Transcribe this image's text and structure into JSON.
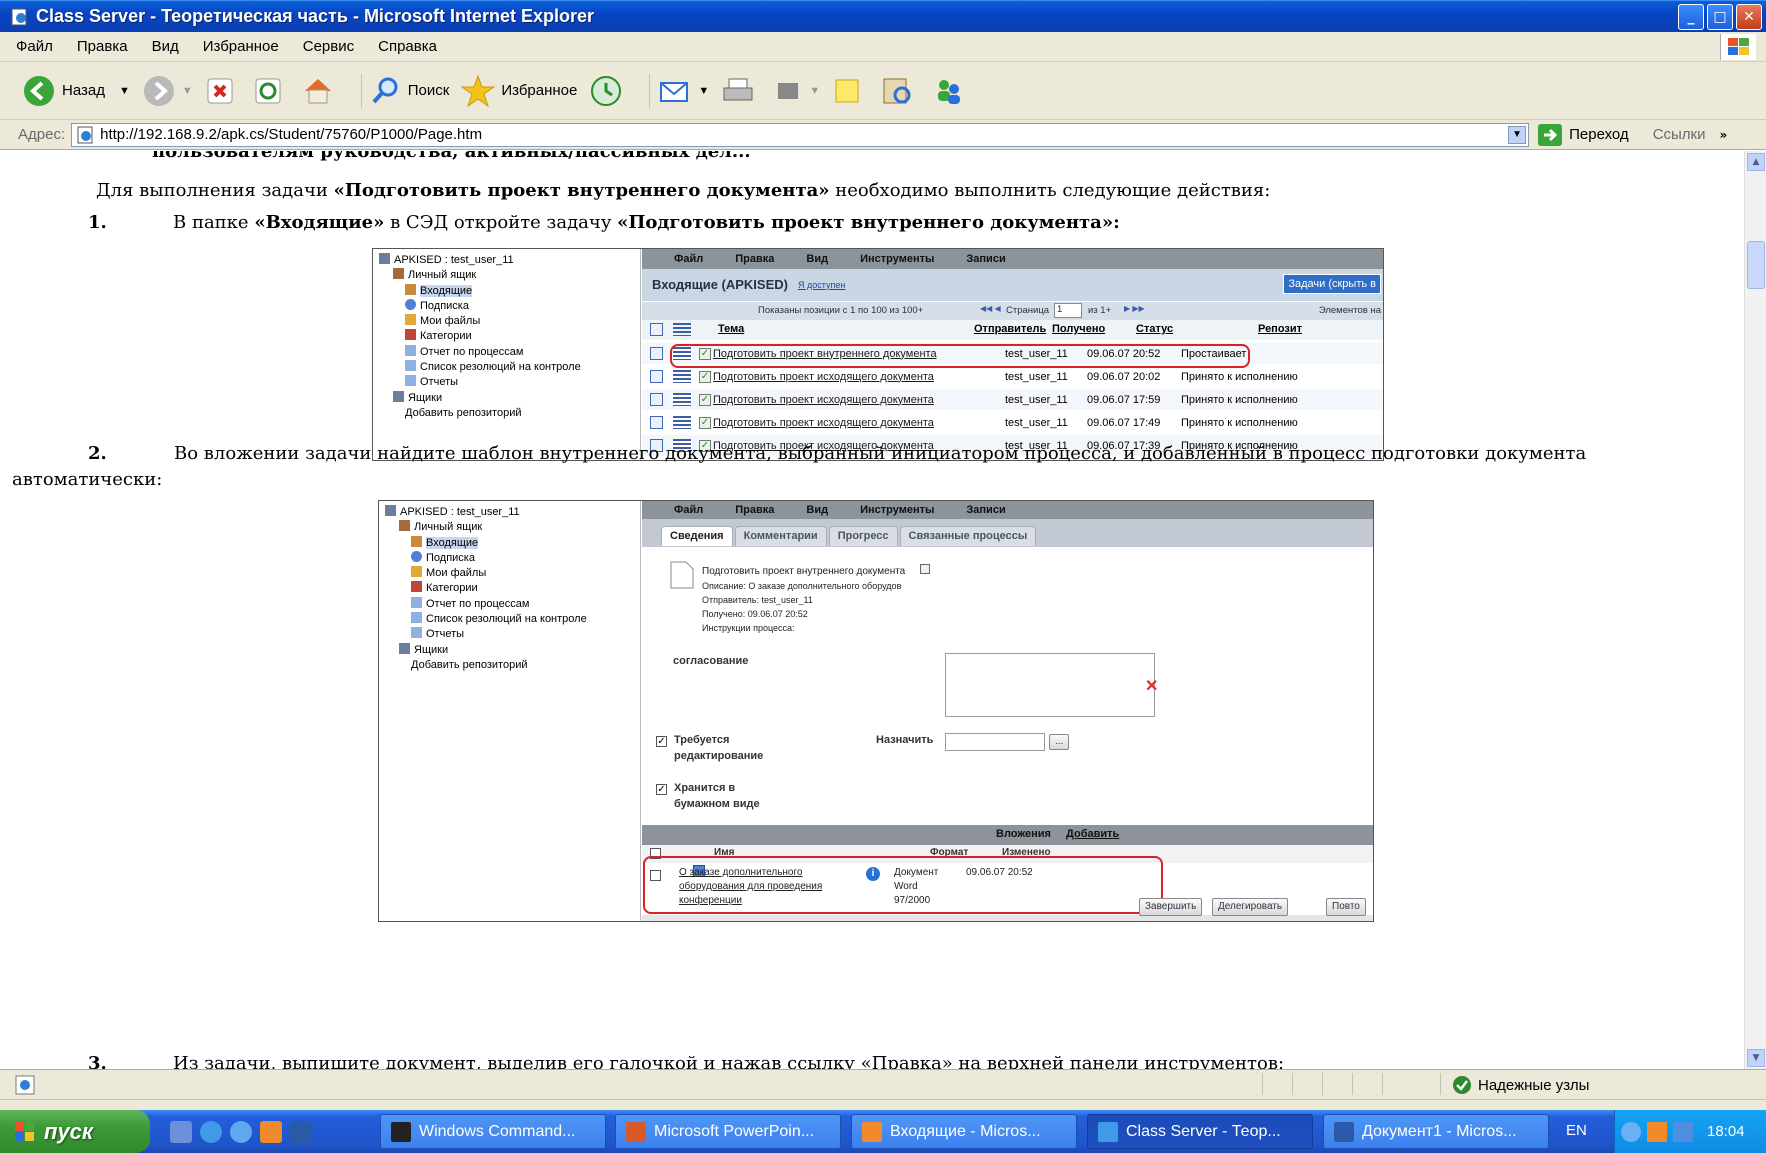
{
  "window": {
    "title": "Class Server - Теоретическая часть - Microsoft Internet Explorer",
    "min_label": "_",
    "max_label": "□",
    "close_label": "✕"
  },
  "menu": [
    "Файл",
    "Правка",
    "Вид",
    "Избранное",
    "Сервис",
    "Справка"
  ],
  "toolbar": {
    "back": "Назад",
    "search": "Поиск",
    "favorites": "Избранное"
  },
  "address": {
    "label": "Адрес:",
    "url": "http://192.168.9.2/apk.cs/Student/75760/P1000/Page.htm",
    "go": "Переход",
    "links": "Ссылки",
    "more": "»"
  },
  "doc": {
    "cut_line": "пользователям руководства, активных/пассивных дел...",
    "intro_pre": "Для выполнения задачи ",
    "intro_bold": "«Подготовить проект внутреннего документа»",
    "intro_post": " необходимо выполнить следующие действия:",
    "step1_num": "1.",
    "step1_pre": "В папке ",
    "step1_b1": "«Входящие»",
    "step1_mid": " в СЭД откройте задачу ",
    "step1_b2": "«Подготовить проект внутреннего документа»:",
    "step2_num": "2.",
    "step2_line1": "Во вложении задачи найдите шаблон внутреннего документа, выбранный инициатором процесса, и добавленный в процесс подготовки документа",
    "step2_line2": "автоматически:",
    "step3_num": "3.",
    "step3_text": "Из задачи, выпишите документ, выделив его галочкой и нажав ссылку «Правка» на верхней панели инструментов:"
  },
  "shot1": {
    "tree": [
      "APKISED : test_user_11",
      "Личный ящик",
      "Входящие",
      "Подписка",
      "Мои файлы",
      "Категории",
      "Отчет по процессам",
      "Список резолюций на контроле",
      "Отчеты",
      "Ящики",
      "Добавить репозиторий"
    ],
    "menu": [
      "Файл",
      "Правка",
      "Вид",
      "Инструменты",
      "Записи"
    ],
    "inbox_title": "Входящие (APKISED)",
    "inbox_avail": "Я доступен",
    "tasks_btn": "Задачи (скрыть в",
    "pager": "Показаны позиции с 1 по 100 из 100+",
    "page_label": "Страница",
    "page_value": "1",
    "page_of": "из 1+",
    "per_page": "Элементов на",
    "columns": [
      "Тема",
      "Отправитель",
      "Получено",
      "Статус",
      "Репозит"
    ],
    "rows": [
      {
        "subject": "Подготовить проект внутреннего документа",
        "from": "test_user_11",
        "received": "09.06.07 20:52",
        "status": "Простаивает"
      },
      {
        "subject": "Подготовить проект исходящего документа",
        "from": "test_user_11",
        "received": "09.06.07 20:02",
        "status": "Принято к исполнению"
      },
      {
        "subject": "Подготовить проект исходящего документа",
        "from": "test_user_11",
        "received": "09.06.07 17:59",
        "status": "Принято к исполнению"
      },
      {
        "subject": "Подготовить проект исходящего документа",
        "from": "test_user_11",
        "received": "09.06.07 17:49",
        "status": "Принято к исполнению"
      },
      {
        "subject": "Подготовить проект исходящего документа",
        "from": "test_user_11",
        "received": "09.06.07 17:39",
        "status": "Принято к исполнению"
      }
    ]
  },
  "shot2": {
    "tree": [
      "APKISED : test_user_11",
      "Личный ящик",
      "Входящие",
      "Подписка",
      "Мои файлы",
      "Категории",
      "Отчет по процессам",
      "Список резолюций на контроле",
      "Отчеты",
      "Ящики",
      "Добавить репозиторий"
    ],
    "menu": [
      "Файл",
      "Правка",
      "Вид",
      "Инструменты",
      "Записи"
    ],
    "tabs": [
      "Сведения",
      "Комментарии",
      "Прогресс",
      "Связанные процессы"
    ],
    "task_title": "Подготовить проект внутреннего документа",
    "desc": "Описание:  О заказе дополнительного оборудов",
    "sender": "Отправитель:  test_user_11",
    "received": "Получено:  09.06.07 20:52",
    "instructions": "Инструкции процесса:",
    "approval": "согласование",
    "requires_edit_1": "Требуется",
    "requires_edit_2": "редактирование",
    "assign": "Назначить",
    "browse": "...",
    "paper_1": "Хранится в",
    "paper_2": "бумажном виде",
    "attachments": "Вложения",
    "add": "Добавить",
    "col_name": "Имя",
    "col_format": "Формат",
    "col_changed": "Изменено",
    "att_name_1": "О заказе дополнительного",
    "att_name_2": "оборудования для проведения",
    "att_name_3": "конференции",
    "att_format_1": "Документ",
    "att_format_2": "Word",
    "att_format_3": "97/2000",
    "att_changed": "09.06.07 20:52",
    "btn_finish": "Завершить",
    "btn_delegate": "Делегировать",
    "btn_repeat": "Повто"
  },
  "status": {
    "trusted": "Надежные узлы"
  },
  "taskbar": {
    "start": "пуск",
    "tasks": [
      "Windows Command...",
      "Microsoft PowerPoin...",
      "Входящие - Micros...",
      "Class Server - Теор...",
      "Документ1 - Micros..."
    ],
    "lang": "EN",
    "clock": "18:04"
  },
  "colors": {
    "titlebar": "#0845c4",
    "highlight": "#d9212a",
    "taskbar": "#245edb",
    "start": "#3c9a37"
  }
}
